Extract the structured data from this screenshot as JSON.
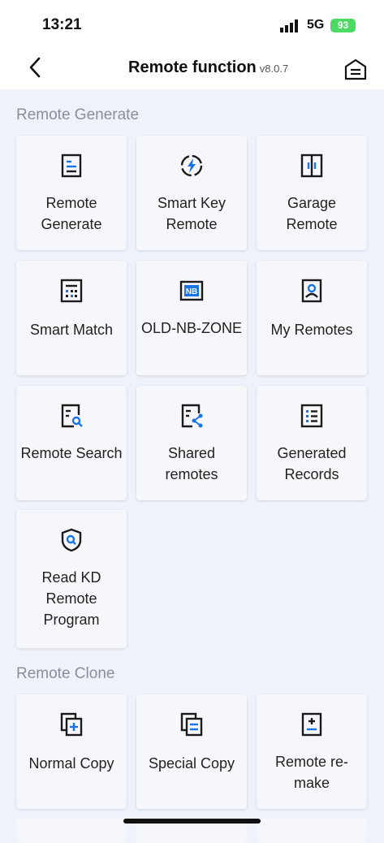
{
  "status": {
    "time": "13:21",
    "network": "5G",
    "battery": "93"
  },
  "header": {
    "title": "Remote function",
    "version": "v8.0.7"
  },
  "sections": [
    {
      "title": "Remote Generate",
      "items": [
        {
          "label": "Remote Generate",
          "icon": "document-list-icon"
        },
        {
          "label": "Smart Key Remote",
          "icon": "smart-key-icon"
        },
        {
          "label": "Garage Remote",
          "icon": "garage-door-icon"
        },
        {
          "label": "Smart Match",
          "icon": "calculator-icon"
        },
        {
          "label": "OLD-NB-ZONE",
          "icon": "nb-badge-icon"
        },
        {
          "label": "My Remotes",
          "icon": "profile-card-icon"
        },
        {
          "label": "Remote Search",
          "icon": "document-search-icon"
        },
        {
          "label": "Shared remotes",
          "icon": "document-share-icon"
        },
        {
          "label": "Generated Records",
          "icon": "records-list-icon"
        },
        {
          "label": "Read KD Remote Program",
          "icon": "shield-search-icon"
        }
      ]
    },
    {
      "title": "Remote Clone",
      "items": [
        {
          "label": "Normal Copy",
          "icon": "copy-plus-icon"
        },
        {
          "label": "Special Copy",
          "icon": "copy-list-icon"
        },
        {
          "label": "Remote re-make",
          "icon": "remake-icon"
        }
      ]
    }
  ],
  "colors": {
    "accent": "#1a73e8",
    "icon_dark": "#1b1b1b",
    "background": "#eef2fa",
    "card": "#f6f7fb"
  }
}
